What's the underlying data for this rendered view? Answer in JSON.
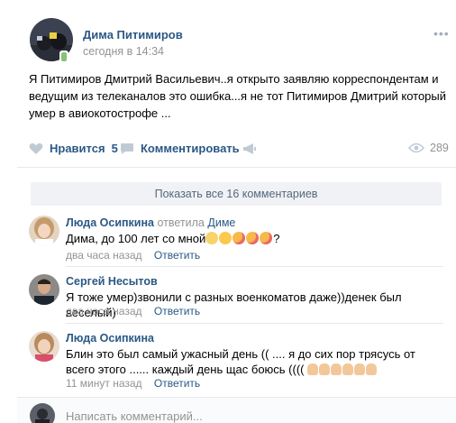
{
  "post": {
    "author": "Дима Питимиров",
    "time": "сегодня в 14:34",
    "menu_icon": "ellipsis-icon",
    "text": "Я Питимиров Дмитрий Васильевич..я открыто заявляю корреспондентам и ведущим из телеканалов это ошибка...я не тот Питимиров Дмитрий который умер в авиокотострофе ...",
    "actions": {
      "like_label": "Нравится",
      "like_count": "5",
      "comment_label": "Комментировать",
      "views": "289"
    }
  },
  "comments_panel": {
    "show_all": "Показать все 16 комментариев",
    "items": [
      {
        "author": "Люда Осипкина",
        "reply_prefix": "ответила",
        "reply_to": "Диме",
        "text": "Дима, до 100 лет со мной",
        "text_tail": "?",
        "time": "два часа назад",
        "reply": "Ответить"
      },
      {
        "author": "Сергей Несытов",
        "text": "Я тоже умер)звонили с разных военкоматов даже))денек был веселый)",
        "time": "два часа назад",
        "reply": "Ответить"
      },
      {
        "author": "Люда Осипкина",
        "text": "Блин это был самый ужасный день (( .... я до сих пор трясусь от всего этого ...... каждый день щас боюсь ((((",
        "time": "11 минут назад",
        "reply": "Ответить"
      }
    ]
  },
  "composer": {
    "placeholder": "Написать комментарий..."
  },
  "colors": {
    "link": "#2a5885",
    "meta": "#939393",
    "divider": "#e7e8ec",
    "show_all_bg": "#f0f2f5"
  }
}
